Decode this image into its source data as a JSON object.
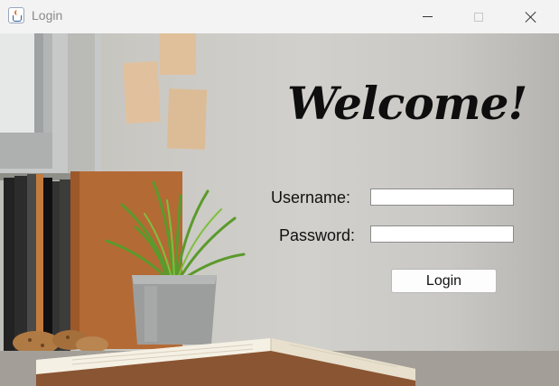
{
  "window": {
    "title": "Login"
  },
  "icons": {
    "app": "java-coffee-cup-icon",
    "minimize": "minimize-icon",
    "maximize": "maximize-icon",
    "close": "close-icon"
  },
  "form": {
    "heading": "Welcome!",
    "username_label": "Username:",
    "password_label": "Password:",
    "username_value": "",
    "password_value": "",
    "login_label": "Login"
  }
}
